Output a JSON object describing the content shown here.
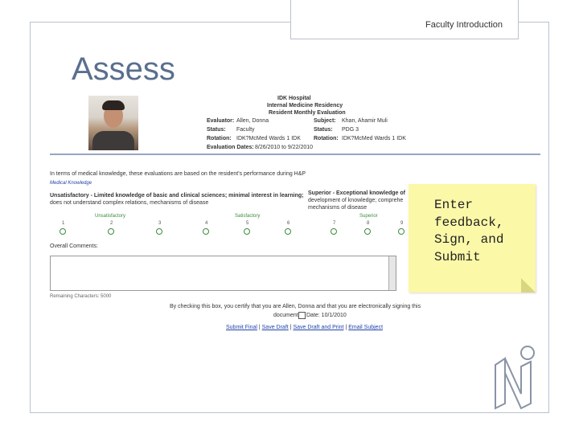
{
  "slide": {
    "header_tab": "Faculty Introduction",
    "title": "Assess"
  },
  "form": {
    "hospital": "IDK Hospital",
    "program": "Internal Medicine Residency",
    "eval_type": "Resident Monthly Evaluation",
    "evaluator_label": "Evaluator:",
    "evaluator_value": "Allen, Donna",
    "status_label": "Status:",
    "status_value": "Faculty",
    "rotation_label": "Rotation:",
    "rotation_value": "IDK?McMed Wards 1 IDK",
    "evaluation_label": "Evaluation Dates:",
    "evaluation_value": "8/26/2010 to 9/22/2010",
    "subject_label": "Subject:",
    "subject_value": "Khan, Ahamir Muli",
    "status2_label": "Status:",
    "status2_value": "PDG 3",
    "rotation2_label": "Rotation:",
    "rotation2_value": "IDK?McMed Wards 1 IDK",
    "question": "In terms of medical knowledge, these evaluations are based on the resident's performance during H&P",
    "competency": "Medical Knowledge",
    "unsat_text_1": "Unsatisfactory - Limited knowledge of basic and clinical sciences; minimal interest in learning;",
    "unsat_text_2": "does not understand complex relations, mechanisms of disease",
    "sup_text_1": "Superior - Exceptional knowledge of",
    "sup_text_2": "development of knowledge; comprehe",
    "sup_text_3": "mechanisms of disease",
    "scale_labels": [
      "Unsatisfactory",
      "Satisfactory",
      "Superior"
    ],
    "scale_numbers": [
      "1",
      "2",
      "3",
      "4",
      "5",
      "6",
      "7",
      "8",
      "9"
    ],
    "overall_label": "Overall Comments:",
    "remaining": "Remaining Characters: 5000",
    "certify_1": "By checking this box, you certify that you are Allen, Donna and that you are electronically signing this",
    "certify_2": "document.",
    "date_label": "Date: 10/1/2010",
    "links": [
      "Submit Final",
      "Save Draft",
      "Save Draft and Print",
      "Email Subject"
    ],
    "sep": "|"
  },
  "sticky_note": {
    "lines": [
      "Enter",
      "feedback,",
      "Sign, and",
      "Submit"
    ]
  }
}
